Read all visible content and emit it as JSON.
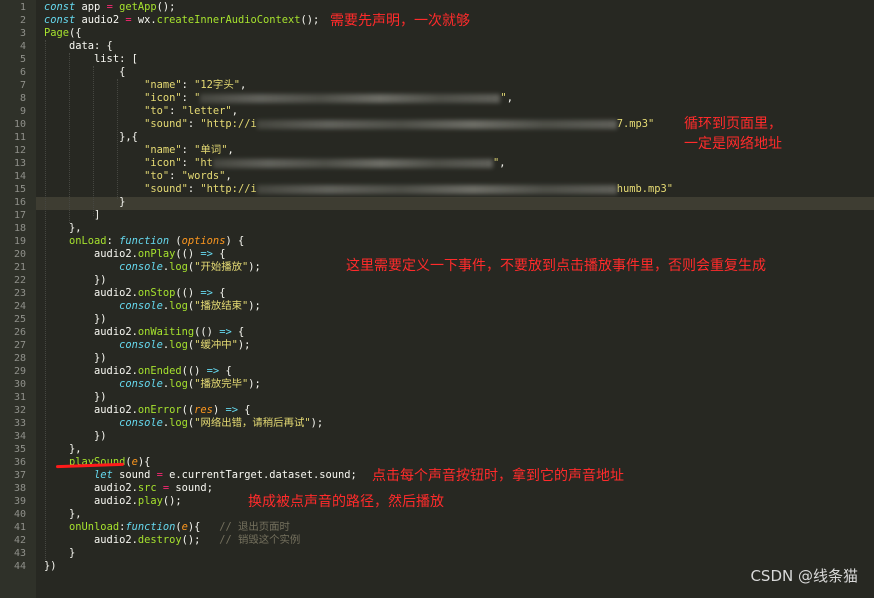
{
  "code_lines": [
    {
      "n": "1"
    },
    {
      "n": "2"
    },
    {
      "n": "3"
    },
    {
      "n": "4"
    },
    {
      "n": "5"
    },
    {
      "n": "6"
    },
    {
      "n": "7"
    },
    {
      "n": "8"
    },
    {
      "n": "9"
    },
    {
      "n": "10"
    },
    {
      "n": "11"
    },
    {
      "n": "12"
    },
    {
      "n": "13"
    },
    {
      "n": "14"
    },
    {
      "n": "15"
    },
    {
      "n": "16"
    },
    {
      "n": "17"
    },
    {
      "n": "18"
    },
    {
      "n": "19"
    },
    {
      "n": "20"
    },
    {
      "n": "21"
    },
    {
      "n": "22"
    },
    {
      "n": "23"
    },
    {
      "n": "24"
    },
    {
      "n": "25"
    },
    {
      "n": "26"
    },
    {
      "n": "27"
    },
    {
      "n": "28"
    },
    {
      "n": "29"
    },
    {
      "n": "30"
    },
    {
      "n": "31"
    },
    {
      "n": "32"
    },
    {
      "n": "33"
    },
    {
      "n": "34"
    },
    {
      "n": "35"
    },
    {
      "n": "36"
    },
    {
      "n": "37"
    },
    {
      "n": "38"
    },
    {
      "n": "39"
    },
    {
      "n": "40"
    },
    {
      "n": "41"
    },
    {
      "n": "42"
    },
    {
      "n": "43"
    },
    {
      "n": "44"
    }
  ],
  "code": {
    "name1": "\"12字头\"",
    "to1": "\"letter\"",
    "sound1_start": "\"http://i",
    "sound1_end": "7.mp3\"",
    "name2": "\"单词\"",
    "icon2_start": "\"ht",
    "to2": "\"words\"",
    "sound2_start": "\"http://i",
    "sound2_end": "humb.mp3\"",
    "log_play": "\"开始播放\"",
    "log_stop": "\"播放结束\"",
    "log_wait": "\"缓冲中\"",
    "log_ended": "\"播放完毕\"",
    "log_error": "\"网络出错，请稍后再试\"",
    "comment_unload": "// 退出页面时",
    "comment_destroy": "// 销毁这个实例"
  },
  "annotations": {
    "declare": "需要先声明，一次就够",
    "loop1": "循环到页面里，",
    "loop2": "一定是网络地址",
    "events": "这里需要定义一下事件，不要放到点击播放事件里，否则会重复生成",
    "click": "点击每个声音按钮时，拿到它的声音地址",
    "switch": "换成被点声音的路径，然后播放"
  },
  "watermark": "CSDN @线条猫",
  "colors": {
    "background": "#272822",
    "annotation": "#ff2b2b",
    "keyword": "#66d9ef",
    "function": "#a6e22e",
    "string": "#e6db74"
  }
}
